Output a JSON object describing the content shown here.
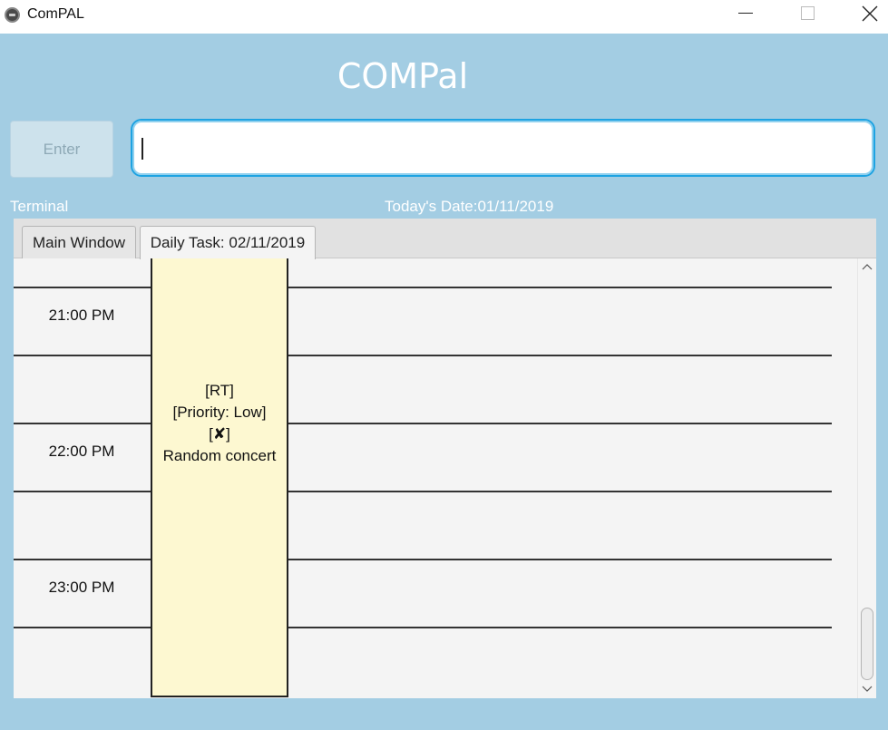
{
  "window": {
    "title": "ComPAL"
  },
  "header": {
    "app_title": "COMPal",
    "enter_label": "Enter",
    "command_input_value": ""
  },
  "labels": {
    "terminal": "Terminal",
    "todays_date": "Today's Date:01/11/2019"
  },
  "tabs": [
    {
      "label": "Main Window",
      "selected": false
    },
    {
      "label": "Daily Task: 02/11/2019",
      "selected": true
    }
  ],
  "schedule": {
    "time_slots": [
      "21:00 PM",
      "22:00 PM",
      "23:00 PM"
    ],
    "event": {
      "type": "[RT]",
      "priority": "[Priority: Low]",
      "status": "[✘]",
      "name": "Random concert",
      "background": "#fdf8d1"
    }
  },
  "colors": {
    "background": "#a3cde3",
    "input_border": "#1ea3e2"
  }
}
